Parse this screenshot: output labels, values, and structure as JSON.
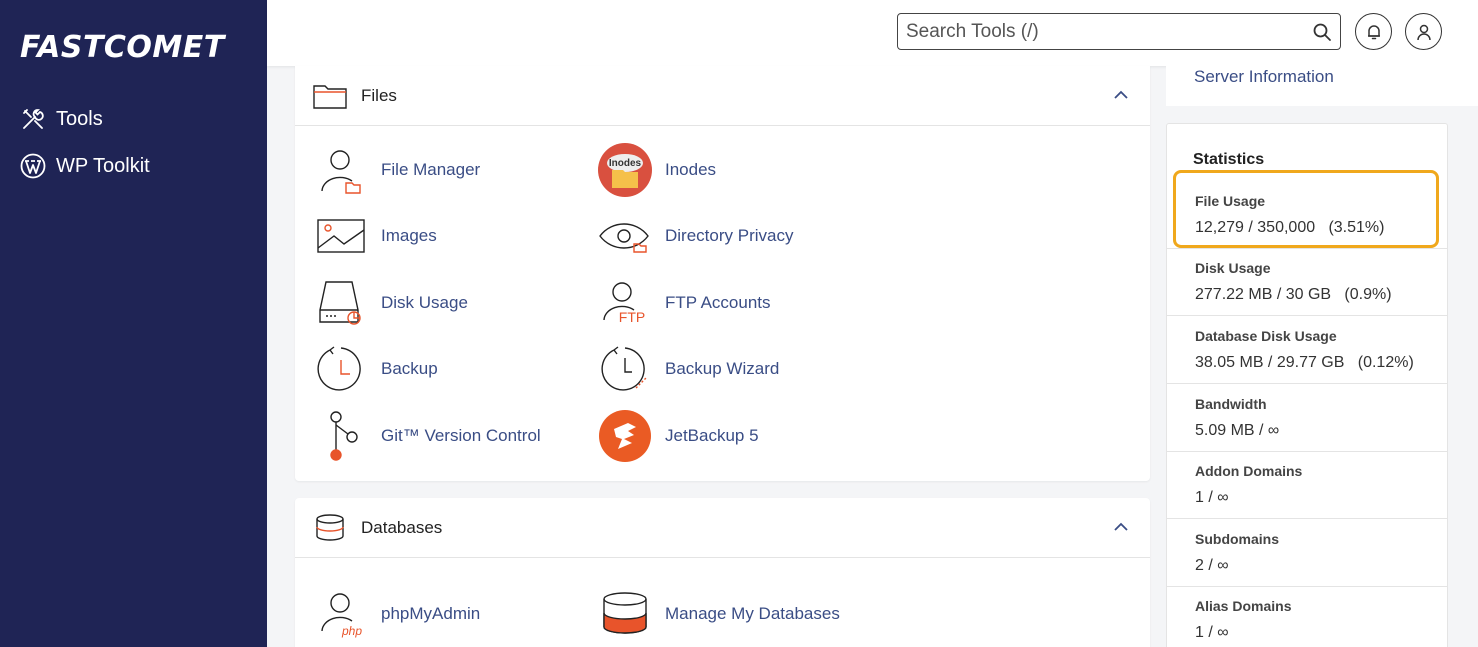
{
  "brand": {
    "logo_text": "FASTCOMET"
  },
  "sidebar": {
    "items": [
      {
        "label": "Tools",
        "icon": "tools-icon"
      },
      {
        "label": "WP Toolkit",
        "icon": "wordpress-icon"
      }
    ]
  },
  "header": {
    "search_placeholder": "Search Tools (/)",
    "icons": [
      "search-icon",
      "bell-icon",
      "user-icon"
    ]
  },
  "sections": [
    {
      "title": "Files",
      "icon": "folder-icon",
      "tools": [
        {
          "label": "File Manager",
          "icon": "file-manager-icon"
        },
        {
          "label": "Inodes",
          "icon": "inodes-icon",
          "icon_text": "Inodes"
        },
        {
          "label": "Images",
          "icon": "images-icon"
        },
        {
          "label": "Directory Privacy",
          "icon": "directory-privacy-icon"
        },
        {
          "label": "Disk Usage",
          "icon": "disk-usage-icon"
        },
        {
          "label": "FTP Accounts",
          "icon": "ftp-accounts-icon",
          "icon_text": "FTP"
        },
        {
          "label": "Backup",
          "icon": "backup-icon"
        },
        {
          "label": "Backup Wizard",
          "icon": "backup-wizard-icon"
        },
        {
          "label": "Git™ Version Control",
          "icon": "git-icon"
        },
        {
          "label": "JetBackup 5",
          "icon": "jetbackup-icon"
        }
      ]
    },
    {
      "title": "Databases",
      "icon": "database-icon",
      "tools": [
        {
          "label": "phpMyAdmin",
          "icon": "phpmyadmin-icon",
          "icon_text": "php"
        },
        {
          "label": "Manage My Databases",
          "icon": "manage-databases-icon"
        }
      ]
    }
  ],
  "right": {
    "server_information": "Server Information",
    "statistics_title": "Statistics",
    "stats": [
      {
        "label": "File Usage",
        "value": "12,279 / 350,000   (3.51%)"
      },
      {
        "label": "Disk Usage",
        "value": "277.22 MB / 30 GB   (0.9%)"
      },
      {
        "label": "Database Disk Usage",
        "value": "38.05 MB / 29.77 GB   (0.12%)"
      },
      {
        "label": "Bandwidth",
        "value": "5.09 MB / ∞"
      },
      {
        "label": "Addon Domains",
        "value": "1 / ∞"
      },
      {
        "label": "Subdomains",
        "value": "2 / ∞"
      },
      {
        "label": "Alias Domains",
        "value": "1 / ∞"
      }
    ]
  },
  "colors": {
    "sidebar_bg": "#1f2455",
    "link": "#3a4d85",
    "accent_orange": "#e8542b",
    "highlight": "#f0a81c"
  }
}
